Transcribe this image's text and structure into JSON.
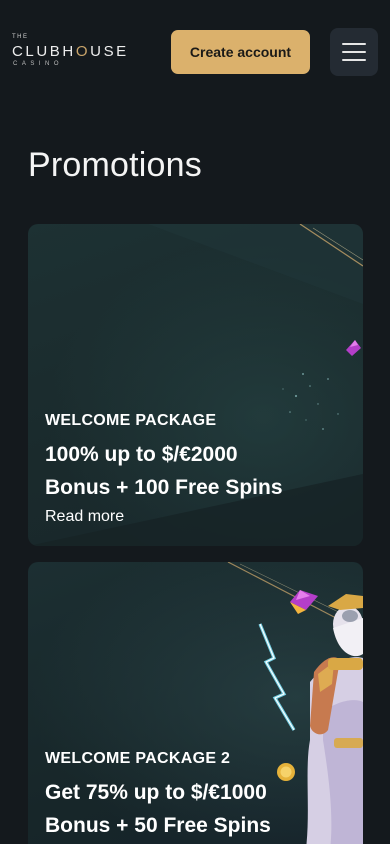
{
  "header": {
    "logo": {
      "top_text": "THE",
      "main_text": "CLUBHOUSE",
      "sub_text": "CASINO"
    },
    "create_account_label": "Create account",
    "menu_icon": "hamburger-menu-icon"
  },
  "page_title": "Promotions",
  "promotions": [
    {
      "label": "WELCOME PACKAGE",
      "headline_line1": "100% up to $/€2000",
      "headline_line2": "Bonus + 100 Free Spins",
      "link_text": "Read more"
    },
    {
      "label": "WELCOME PACKAGE 2",
      "headline_line1": "Get 75% up to $/€1000",
      "headline_line2": "Bonus + 50 Free Spins"
    }
  ],
  "colors": {
    "background": "#14191d",
    "accent_button": "#dbb16c",
    "card_background": "#1a2b2e",
    "menu_button": "#242b33"
  }
}
